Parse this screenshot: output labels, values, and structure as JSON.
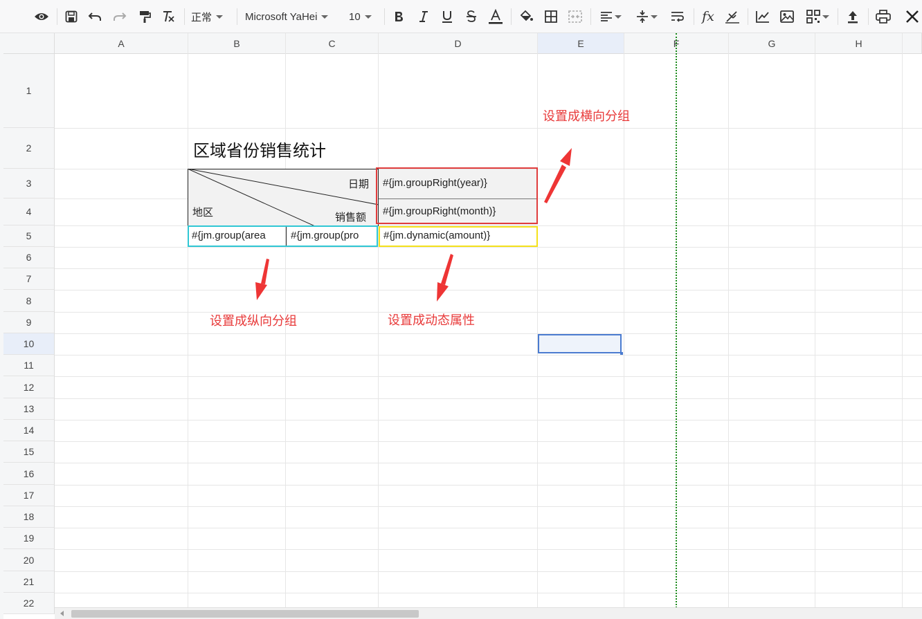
{
  "toolbar": {
    "style_select": "正常",
    "font_select": "Microsoft YaHei",
    "size_select": "10",
    "fx_label": "fx"
  },
  "columns": [
    "A",
    "B",
    "C",
    "D",
    "E",
    "F",
    "G",
    "H"
  ],
  "rows": [
    "1",
    "2",
    "3",
    "4",
    "5",
    "6",
    "7",
    "8",
    "9",
    "10",
    "11",
    "12",
    "13",
    "14",
    "15",
    "16",
    "17",
    "18",
    "19",
    "20",
    "21",
    "22"
  ],
  "report": {
    "title": "区域省份销售统计",
    "header_date": "日期",
    "header_amount": "销售额",
    "header_region": "地区",
    "cell_year": "#{jm.groupRight(year)}",
    "cell_month": "#{jm.groupRight(month)}",
    "cell_area": "#{jm.group(area",
    "cell_province": "#{jm.group(pro",
    "cell_amount": "#{jm.dynamic(amount)}"
  },
  "annotations": {
    "horizontal_group": "设置成横向分组",
    "vertical_group": "设置成纵向分组",
    "dynamic_attr": "设置成动态属性"
  },
  "colors": {
    "annotation_red": "#e83a3a",
    "cyan_border": "#2fc7d4",
    "yellow_border": "#f5e11a",
    "red_border": "#e03c3c",
    "selection_blue": "#4a7bd0",
    "page_break_green": "#1a8a1a"
  }
}
